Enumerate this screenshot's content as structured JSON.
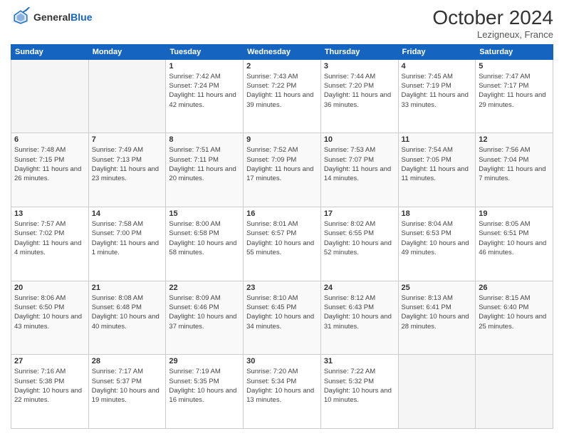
{
  "header": {
    "logo_general": "General",
    "logo_blue": "Blue",
    "month_year": "October 2024",
    "location": "Lezigneux, France"
  },
  "days_of_week": [
    "Sunday",
    "Monday",
    "Tuesday",
    "Wednesday",
    "Thursday",
    "Friday",
    "Saturday"
  ],
  "weeks": [
    [
      {
        "day": "",
        "empty": true
      },
      {
        "day": "",
        "empty": true
      },
      {
        "day": "1",
        "sunrise": "7:42 AM",
        "sunset": "7:24 PM",
        "daylight": "11 hours and 42 minutes."
      },
      {
        "day": "2",
        "sunrise": "7:43 AM",
        "sunset": "7:22 PM",
        "daylight": "11 hours and 39 minutes."
      },
      {
        "day": "3",
        "sunrise": "7:44 AM",
        "sunset": "7:20 PM",
        "daylight": "11 hours and 36 minutes."
      },
      {
        "day": "4",
        "sunrise": "7:45 AM",
        "sunset": "7:19 PM",
        "daylight": "11 hours and 33 minutes."
      },
      {
        "day": "5",
        "sunrise": "7:47 AM",
        "sunset": "7:17 PM",
        "daylight": "11 hours and 29 minutes."
      }
    ],
    [
      {
        "day": "6",
        "sunrise": "7:48 AM",
        "sunset": "7:15 PM",
        "daylight": "11 hours and 26 minutes."
      },
      {
        "day": "7",
        "sunrise": "7:49 AM",
        "sunset": "7:13 PM",
        "daylight": "11 hours and 23 minutes."
      },
      {
        "day": "8",
        "sunrise": "7:51 AM",
        "sunset": "7:11 PM",
        "daylight": "11 hours and 20 minutes."
      },
      {
        "day": "9",
        "sunrise": "7:52 AM",
        "sunset": "7:09 PM",
        "daylight": "11 hours and 17 minutes."
      },
      {
        "day": "10",
        "sunrise": "7:53 AM",
        "sunset": "7:07 PM",
        "daylight": "11 hours and 14 minutes."
      },
      {
        "day": "11",
        "sunrise": "7:54 AM",
        "sunset": "7:05 PM",
        "daylight": "11 hours and 11 minutes."
      },
      {
        "day": "12",
        "sunrise": "7:56 AM",
        "sunset": "7:04 PM",
        "daylight": "11 hours and 7 minutes."
      }
    ],
    [
      {
        "day": "13",
        "sunrise": "7:57 AM",
        "sunset": "7:02 PM",
        "daylight": "11 hours and 4 minutes."
      },
      {
        "day": "14",
        "sunrise": "7:58 AM",
        "sunset": "7:00 PM",
        "daylight": "11 hours and 1 minute."
      },
      {
        "day": "15",
        "sunrise": "8:00 AM",
        "sunset": "6:58 PM",
        "daylight": "10 hours and 58 minutes."
      },
      {
        "day": "16",
        "sunrise": "8:01 AM",
        "sunset": "6:57 PM",
        "daylight": "10 hours and 55 minutes."
      },
      {
        "day": "17",
        "sunrise": "8:02 AM",
        "sunset": "6:55 PM",
        "daylight": "10 hours and 52 minutes."
      },
      {
        "day": "18",
        "sunrise": "8:04 AM",
        "sunset": "6:53 PM",
        "daylight": "10 hours and 49 minutes."
      },
      {
        "day": "19",
        "sunrise": "8:05 AM",
        "sunset": "6:51 PM",
        "daylight": "10 hours and 46 minutes."
      }
    ],
    [
      {
        "day": "20",
        "sunrise": "8:06 AM",
        "sunset": "6:50 PM",
        "daylight": "10 hours and 43 minutes."
      },
      {
        "day": "21",
        "sunrise": "8:08 AM",
        "sunset": "6:48 PM",
        "daylight": "10 hours and 40 minutes."
      },
      {
        "day": "22",
        "sunrise": "8:09 AM",
        "sunset": "6:46 PM",
        "daylight": "10 hours and 37 minutes."
      },
      {
        "day": "23",
        "sunrise": "8:10 AM",
        "sunset": "6:45 PM",
        "daylight": "10 hours and 34 minutes."
      },
      {
        "day": "24",
        "sunrise": "8:12 AM",
        "sunset": "6:43 PM",
        "daylight": "10 hours and 31 minutes."
      },
      {
        "day": "25",
        "sunrise": "8:13 AM",
        "sunset": "6:41 PM",
        "daylight": "10 hours and 28 minutes."
      },
      {
        "day": "26",
        "sunrise": "8:15 AM",
        "sunset": "6:40 PM",
        "daylight": "10 hours and 25 minutes."
      }
    ],
    [
      {
        "day": "27",
        "sunrise": "7:16 AM",
        "sunset": "5:38 PM",
        "daylight": "10 hours and 22 minutes."
      },
      {
        "day": "28",
        "sunrise": "7:17 AM",
        "sunset": "5:37 PM",
        "daylight": "10 hours and 19 minutes."
      },
      {
        "day": "29",
        "sunrise": "7:19 AM",
        "sunset": "5:35 PM",
        "daylight": "10 hours and 16 minutes."
      },
      {
        "day": "30",
        "sunrise": "7:20 AM",
        "sunset": "5:34 PM",
        "daylight": "10 hours and 13 minutes."
      },
      {
        "day": "31",
        "sunrise": "7:22 AM",
        "sunset": "5:32 PM",
        "daylight": "10 hours and 10 minutes."
      },
      {
        "day": "",
        "empty": true
      },
      {
        "day": "",
        "empty": true
      }
    ]
  ],
  "labels": {
    "sunrise": "Sunrise:",
    "sunset": "Sunset:",
    "daylight": "Daylight:"
  }
}
